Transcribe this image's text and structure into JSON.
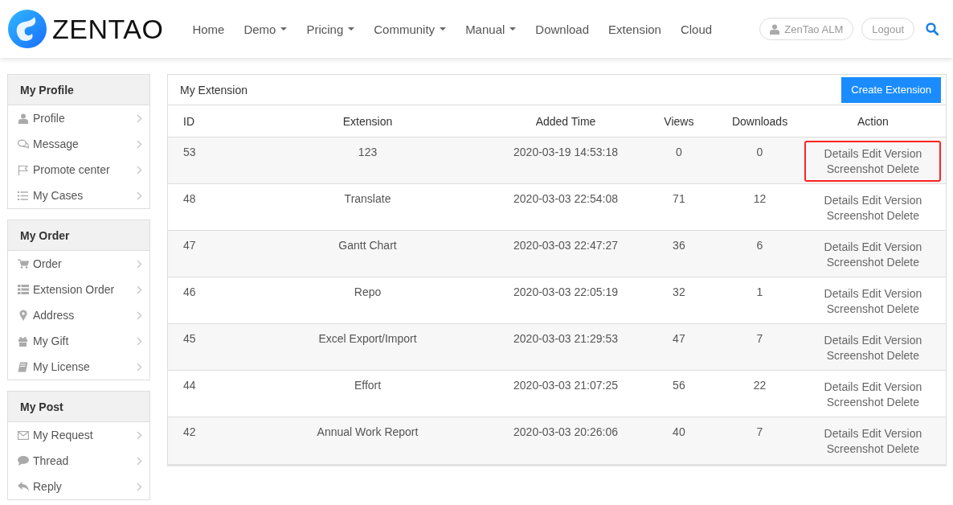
{
  "header": {
    "logo": "ZENTAO",
    "nav": [
      {
        "label": "Home",
        "has_menu": false
      },
      {
        "label": "Demo",
        "has_menu": true
      },
      {
        "label": "Pricing",
        "has_menu": true
      },
      {
        "label": "Community",
        "has_menu": true
      },
      {
        "label": "Manual",
        "has_menu": true
      },
      {
        "label": "Download",
        "has_menu": false
      },
      {
        "label": "Extension",
        "has_menu": false
      },
      {
        "label": "Cloud",
        "has_menu": false
      }
    ],
    "user": "ZenTao ALM",
    "logout": "Logout"
  },
  "sidebar": [
    {
      "title": "My Profile",
      "items": [
        "Profile",
        "Message",
        "Promote center",
        "My Cases"
      ]
    },
    {
      "title": "My Order",
      "items": [
        "Order",
        "Extension Order",
        "Address",
        "My Gift",
        "My License"
      ]
    },
    {
      "title": "My Post",
      "items": [
        "My Request",
        "Thread",
        "Reply"
      ]
    }
  ],
  "panel": {
    "title": "My Extension",
    "create_button": "Create Extension",
    "columns": [
      "ID",
      "Extension",
      "Added Time",
      "Views",
      "Downloads",
      "Action"
    ],
    "rows": [
      {
        "id": "53",
        "extension": "123",
        "added_time": "2020-03-19 14:53:18",
        "views": "0",
        "downloads": "0",
        "actions": [
          "Details",
          "Edit",
          "Version",
          "Screenshot",
          "Delete"
        ],
        "highlighted": true
      },
      {
        "id": "48",
        "extension": "Translate",
        "added_time": "2020-03-03 22:54:08",
        "views": "71",
        "downloads": "12",
        "actions": [
          "Details",
          "Edit",
          "Version",
          "Screenshot",
          "Delete"
        ],
        "highlighted": false
      },
      {
        "id": "47",
        "extension": "Gantt Chart",
        "added_time": "2020-03-03 22:47:27",
        "views": "36",
        "downloads": "6",
        "actions": [
          "Details",
          "Edit",
          "Version",
          "Screenshot",
          "Delete"
        ],
        "highlighted": false
      },
      {
        "id": "46",
        "extension": "Repo",
        "added_time": "2020-03-03 22:05:19",
        "views": "32",
        "downloads": "1",
        "actions": [
          "Details",
          "Edit",
          "Version",
          "Screenshot",
          "Delete"
        ],
        "highlighted": false
      },
      {
        "id": "45",
        "extension": "Excel Export/Import",
        "added_time": "2020-03-03 21:29:53",
        "views": "47",
        "downloads": "7",
        "actions": [
          "Details",
          "Edit",
          "Version",
          "Screenshot",
          "Delete"
        ],
        "highlighted": false
      },
      {
        "id": "44",
        "extension": "Effort",
        "added_time": "2020-03-03 21:07:25",
        "views": "56",
        "downloads": "22",
        "actions": [
          "Details",
          "Edit",
          "Version",
          "Screenshot",
          "Delete"
        ],
        "highlighted": false
      },
      {
        "id": "42",
        "extension": "Annual Work Report",
        "added_time": "2020-03-03 20:26:06",
        "views": "40",
        "downloads": "7",
        "actions": [
          "Details",
          "Edit",
          "Version",
          "Screenshot",
          "Delete"
        ],
        "highlighted": false
      }
    ]
  }
}
